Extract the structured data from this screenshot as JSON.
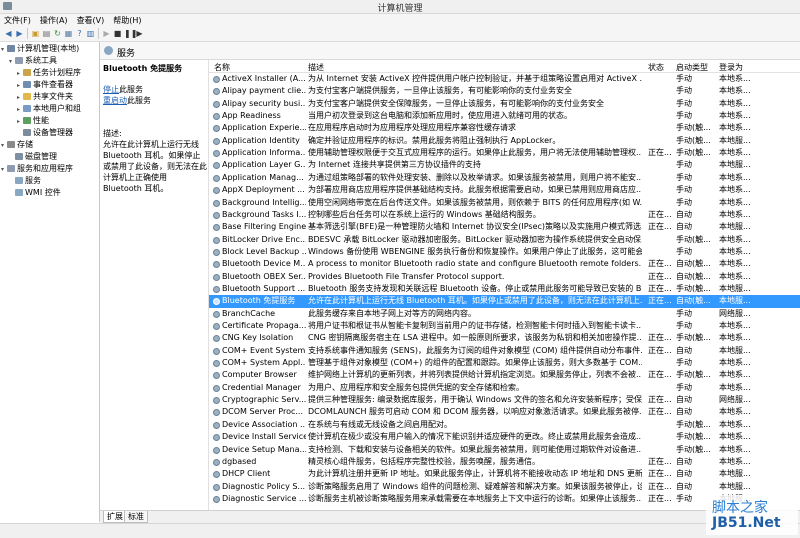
{
  "window": {
    "title": "计算机管理"
  },
  "menu": [
    "文件(F)",
    "操作(A)",
    "查看(V)",
    "帮助(H)"
  ],
  "toolbar_icons": [
    "back-arrow-icon",
    "forward-arrow-icon",
    "show-hide-tree-icon",
    "properties-icon",
    "refresh-icon",
    "export-list-icon",
    "help-icon",
    "play-icon",
    "stop-icon",
    "pause-icon",
    "restart-icon"
  ],
  "tree": [
    {
      "label": "计算机管理(本地)",
      "level": 0,
      "twisty": "▾",
      "color": "#6f87a3"
    },
    {
      "label": "系统工具",
      "level": 1,
      "twisty": "▾",
      "color": "#8f9bb0"
    },
    {
      "label": "任务计划程序",
      "level": 2,
      "twisty": "▸",
      "color": "#c9a44b"
    },
    {
      "label": "事件查看器",
      "level": 2,
      "twisty": "▸",
      "color": "#6f8fb0"
    },
    {
      "label": "共享文件夹",
      "level": 2,
      "twisty": "▸",
      "color": "#e0b94a"
    },
    {
      "label": "本地用户和组",
      "level": 2,
      "twisty": "▸",
      "color": "#7b9bc7"
    },
    {
      "label": "性能",
      "level": 2,
      "twisty": "▸",
      "color": "#5e9e5e"
    },
    {
      "label": "设备管理器",
      "level": 2,
      "twisty": "",
      "color": "#7c8c9c"
    },
    {
      "label": "存储",
      "level": 1,
      "twisty": "▾",
      "color": "#8a8a8a"
    },
    {
      "label": "磁盘管理",
      "level": 2,
      "twisty": "",
      "color": "#7d8fa3"
    },
    {
      "label": "服务和应用程序",
      "level": 1,
      "twisty": "▾",
      "color": "#8f9bb0"
    },
    {
      "label": "服务",
      "level": 2,
      "twisty": "",
      "color": "#8aa7c2"
    },
    {
      "label": "WMI 控件",
      "level": 2,
      "twisty": "",
      "color": "#8aa7c2"
    }
  ],
  "pane_title": "服务",
  "description": {
    "service_name": "Bluetooth 免提服务",
    "stop_link": "停止",
    "stop_suffix": "此服务",
    "restart_link": "重启动",
    "restart_suffix": "此服务",
    "label": "描述:",
    "text": "允许在此计算机上运行无线 Bluetooth 耳机。如果停止或禁用了此设备，则无法在此计算机上正确使用 Bluetooth 耳机。"
  },
  "columns": {
    "name": "名称",
    "desc": "描述",
    "status": "状态",
    "startup": "启动类型",
    "logon": "登录为"
  },
  "services": [
    {
      "name": "ActiveX Installer (A...",
      "desc": "为从 Internet 安装 ActiveX 控件提供用户帐户控制验证，并基于组策略设置启用对 ActiveX ...",
      "status": "",
      "startup": "手动",
      "logon": "本地系..."
    },
    {
      "name": "Alipay payment clie...",
      "desc": "为支付宝客户端提供服务，一旦停止该服务，有可能影响你的支付业务安全",
      "status": "",
      "startup": "手动",
      "logon": "本地系..."
    },
    {
      "name": "Alipay security busi...",
      "desc": "为支付宝客户端提供安全保障服务，一旦停止该服务，有可能影响你的支付业务安全",
      "status": "",
      "startup": "手动",
      "logon": "本地系..."
    },
    {
      "name": "App Readiness",
      "desc": "当用户初次登录到这台电脑和添加新应用时，使应用进入就绪可用的状态。",
      "status": "",
      "startup": "手动",
      "logon": "本地系..."
    },
    {
      "name": "Application Experie...",
      "desc": "在应用程序启动时为应用程序处理应用程序兼容性缓存请求",
      "status": "",
      "startup": "手动(触...",
      "logon": "本地系..."
    },
    {
      "name": "Application Identity",
      "desc": "确定并验证应用程序的标识。禁用此服务将阻止强制执行 AppLocker。",
      "status": "",
      "startup": "手动(触...",
      "logon": "本地服..."
    },
    {
      "name": "Application Informa...",
      "desc": "使用辅助管理权限便于交互式应用程序的运行。如果停止此服务，用户将无法使用辅助管理权...",
      "status": "正在...",
      "startup": "手动(触...",
      "logon": "本地系..."
    },
    {
      "name": "Application Layer G...",
      "desc": "为 Internet 连接共享提供第三方协议插件的支持",
      "status": "",
      "startup": "手动",
      "logon": "本地服..."
    },
    {
      "name": "Application Manag...",
      "desc": "为通过组策略部署的软件处理安装、删除以及枚举请求。如果该服务被禁用，则用户将不能安...",
      "status": "",
      "startup": "手动",
      "logon": "本地系..."
    },
    {
      "name": "AppX Deployment ...",
      "desc": "为部署应用商店应用程序提供基础结构支持。此服务根据需要启动，如果已禁用则应用商店应...",
      "status": "",
      "startup": "手动",
      "logon": "本地系..."
    },
    {
      "name": "Background Intellig...",
      "desc": "使用空闲网络带宽在后台传送文件。如果该服务被禁用，则依赖于 BITS 的任何应用程序(如 W...",
      "status": "",
      "startup": "手动",
      "logon": "本地系..."
    },
    {
      "name": "Background Tasks I...",
      "desc": "控制哪些后台任务可以在系统上运行的 Windows 基础结构服务。",
      "status": "正在...",
      "startup": "自动",
      "logon": "本地系..."
    },
    {
      "name": "Base Filtering Engine",
      "desc": "基本筛选引擎(BFE)是一种管理防火墙和 Internet 协议安全(IPsec)策略以及实施用户模式筛选...",
      "status": "正在...",
      "startup": "自动",
      "logon": "本地服..."
    },
    {
      "name": "BitLocker Drive Enc...",
      "desc": "BDESVC 承载 BitLocker 驱动器加密服务。BitLocker 驱动器加密为操作系统提供安全启动保...",
      "status": "",
      "startup": "手动(触...",
      "logon": "本地系..."
    },
    {
      "name": "Block Level Backup ...",
      "desc": "Windows 备份使用 WBENGINE 服务执行备份和恢复操作。如果用户停止了此服务，这可能会...",
      "status": "",
      "startup": "手动",
      "logon": "本地系..."
    },
    {
      "name": "Bluetooth Device M...",
      "desc": "A process to monitor Bluetooth radio state and configure Bluetooth remote folders.",
      "status": "正在...",
      "startup": "自动(触...",
      "logon": "本地系..."
    },
    {
      "name": "Bluetooth OBEX Ser...",
      "desc": "Provides Bluetooth File Transfer Protocol support.",
      "status": "正在...",
      "startup": "自动(触...",
      "logon": "本地系..."
    },
    {
      "name": "Bluetooth Support ...",
      "desc": "Bluetooth 服务支持发现和关联远程 Bluetooth 设备。停止或禁用此服务可能导致已安装的 Bl...",
      "status": "正在...",
      "startup": "手动(触...",
      "logon": "本地服..."
    },
    {
      "name": "Bluetooth 免提服务",
      "desc": "允许在此计算机上运行无线 Bluetooth 耳机。如果停止或禁用了此设备，则无法在此计算机上...",
      "status": "正在...",
      "startup": "自动(触...",
      "logon": "本地服...",
      "selected": true
    },
    {
      "name": "BranchCache",
      "desc": "此服务缓存来自本地子网上对等方的网络内容。",
      "status": "",
      "startup": "手动",
      "logon": "网络服..."
    },
    {
      "name": "Certificate Propaga...",
      "desc": "将用户证书和根证书从智能卡复制到当前用户的证书存储，检测智能卡何时插入到智能卡读卡...",
      "status": "",
      "startup": "手动",
      "logon": "本地系..."
    },
    {
      "name": "CNG Key Isolation",
      "desc": "CNG 密钥隔离服务宿主在 LSA 进程中。如一般原则所要求，该服务为私钥和相关加密操作提...",
      "status": "正在...",
      "startup": "手动(触...",
      "logon": "本地系..."
    },
    {
      "name": "COM+ Event System",
      "desc": "支持系统事件通知服务 (SENS)，此服务为订阅的组件对象模型 (COM) 组件提供自动分布事件...",
      "status": "正在...",
      "startup": "自动",
      "logon": "本地服..."
    },
    {
      "name": "COM+ System Appl...",
      "desc": "管理基于组件对象模型 (COM+) 的组件的配置和跟踪。如果停止该服务，则大多数基于 COM...",
      "status": "",
      "startup": "手动",
      "logon": "本地系..."
    },
    {
      "name": "Computer Browser",
      "desc": "维护网络上计算机的更新列表，并将列表提供给计算机指定浏览。如果服务停止，列表不会被...",
      "status": "正在...",
      "startup": "手动(触...",
      "logon": "本地系..."
    },
    {
      "name": "Credential Manager",
      "desc": "为用户、应用程序和安全服务包提供凭据的安全存储和检索。",
      "status": "",
      "startup": "手动",
      "logon": "本地系..."
    },
    {
      "name": "Cryptographic Serv...",
      "desc": "提供三种管理服务: 编录数据库服务，用于确认 Windows 文件的签名和允许安装新程序；受保...",
      "status": "正在...",
      "startup": "自动",
      "logon": "网络服..."
    },
    {
      "name": "DCOM Server Proc...",
      "desc": "DCOMLAUNCH 服务可启动 COM 和 DCOM 服务器，以响应对象激活请求。如果此服务被停...",
      "status": "正在...",
      "startup": "自动",
      "logon": "本地系..."
    },
    {
      "name": "Device Association ...",
      "desc": "在系统与有线或无线设备之间启用配对。",
      "status": "",
      "startup": "手动(触...",
      "logon": "本地系..."
    },
    {
      "name": "Device Install Service",
      "desc": "使计算机在极少或没有用户输入的情况下能识别并适应硬件的更改。终止或禁用此服务会造成...",
      "status": "",
      "startup": "手动(触...",
      "logon": "本地系..."
    },
    {
      "name": "Device Setup Mana...",
      "desc": "支持检测、下载和安装与设备相关的软件。如果此服务被禁用，则可能使用过期软件对设备进...",
      "status": "",
      "startup": "手动(触...",
      "logon": "本地系..."
    },
    {
      "name": "dgbased",
      "desc": "精灵核心组件服务，包括程序完整性校验，服务唤醒，服务通信。",
      "status": "正在...",
      "startup": "自动",
      "logon": "本地系..."
    },
    {
      "name": "DHCP Client",
      "desc": "为此计算机注册并更新 IP 地址。如果此服务停止，计算机将不能接收动态 IP 地址和 DNS 更新...",
      "status": "正在...",
      "startup": "自动",
      "logon": "本地服..."
    },
    {
      "name": "Diagnostic Policy S...",
      "desc": "诊断策略服务启用了 Windows 组件的问题检测、疑难解答和解决方案。如果该服务被停止，诊...",
      "status": "正在...",
      "startup": "自动",
      "logon": "本地服..."
    },
    {
      "name": "Diagnostic Service ...",
      "desc": "诊断服务主机被诊断策略服务用来承载需要在本地服务上下文中运行的诊断。如果停止该服务...",
      "status": "正在...",
      "startup": "手动",
      "logon": "本地服..."
    }
  ],
  "tabs": [
    "扩展",
    "标准"
  ],
  "watermark": {
    "line1": "脚本之家",
    "line2": "JB51.Net"
  },
  "colors": {
    "selection": "#3399ff",
    "link": "#1a5fb4"
  }
}
